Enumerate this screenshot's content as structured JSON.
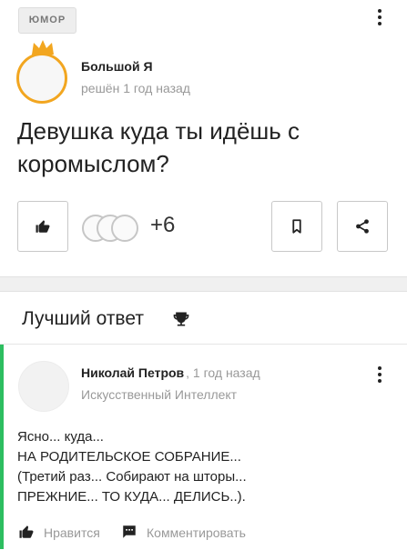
{
  "question": {
    "category_tag": "ЮМОР",
    "author": {
      "name": "Большой Я",
      "meta": "решён 1 год назад"
    },
    "title": "Девушка куда ты идёшь с коромыслом?",
    "likes_extra": "+6"
  },
  "best_answer": {
    "header": "Лучший ответ",
    "author": {
      "name": "Николай Петров",
      "time": ", 1 год назад",
      "role": "Искусственный Интеллект"
    },
    "text_lines": [
      "Ясно... куда...",
      "НА РОДИТЕЛЬСКОЕ СОБРАНИЕ...",
      "(Третий раз... Собирают на шторы...",
      "ПРЕЖНИЕ... ТО КУДА... ДЕЛИСЬ..)."
    ],
    "actions": {
      "like_label": "Нравится",
      "comment_label": "Комментировать"
    }
  },
  "colors": {
    "crown": "#f2a620",
    "best_answer_accent": "#2dbe60",
    "muted_text": "#999999"
  },
  "icons": {
    "like": "thumbs-up-icon",
    "bookmark": "bookmark-icon",
    "share": "share-icon",
    "more": "more-vertical-icon",
    "trophy": "trophy-icon",
    "comment": "comment-icon",
    "crown": "crown-icon"
  }
}
